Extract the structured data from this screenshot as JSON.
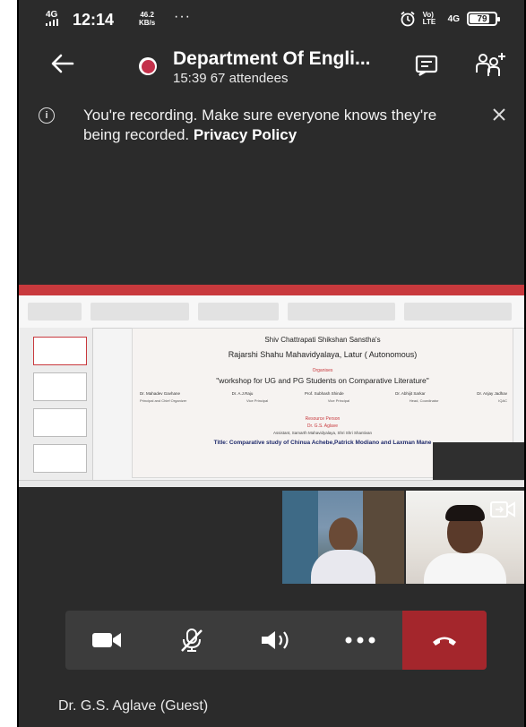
{
  "status_bar": {
    "network": "4G",
    "time": "12:14",
    "speed_value": "46.2",
    "speed_unit": "KB/s",
    "more": "···",
    "right_network": "4G",
    "volte": "Vo) LTE",
    "battery_level": 79,
    "battery_text": "79"
  },
  "header": {
    "title": "Department Of Engli...",
    "duration": "15:39",
    "attendees": "67 attendees",
    "recording_color": "#c4314b"
  },
  "banner": {
    "message": "You're recording. Make sure everyone knows they're being recorded.",
    "link": "Privacy Policy"
  },
  "slide": {
    "line1": "Shiv Chattrapati Shikshan Sanstha's",
    "line2": "Rajarshi Shahu Mahavidyalaya, Latur  ( Autonomous)",
    "line3": "Organises",
    "line4": "\"workshop for UG and PG Students on Comparative Literature\"",
    "people": [
      "Dr. Mahadev Gavhane",
      "Dr. A.J.Raju",
      "Prof. Subhash Shinde",
      "Dr. Abhijit Sarkar",
      "Dr. Anjay Jadhav"
    ],
    "roles": [
      "Principal and Chief Organizer",
      "Vice Principal",
      "Vice Principal",
      "Head, Coordinator",
      "IQAC"
    ],
    "line6": "Resource Person",
    "line7": "Dr. G.S. Aglave",
    "line8": "Assistant, Samarth Mahavidyalaya, Shri Shri Shantivan",
    "line9": "Title: Comparative study of Chinua Achebe,Patrick Modiano and Laxman Mane"
  },
  "controls": {
    "hangup_color": "#a4262c"
  },
  "participant": "Dr. G.S. Aglave (Guest)"
}
